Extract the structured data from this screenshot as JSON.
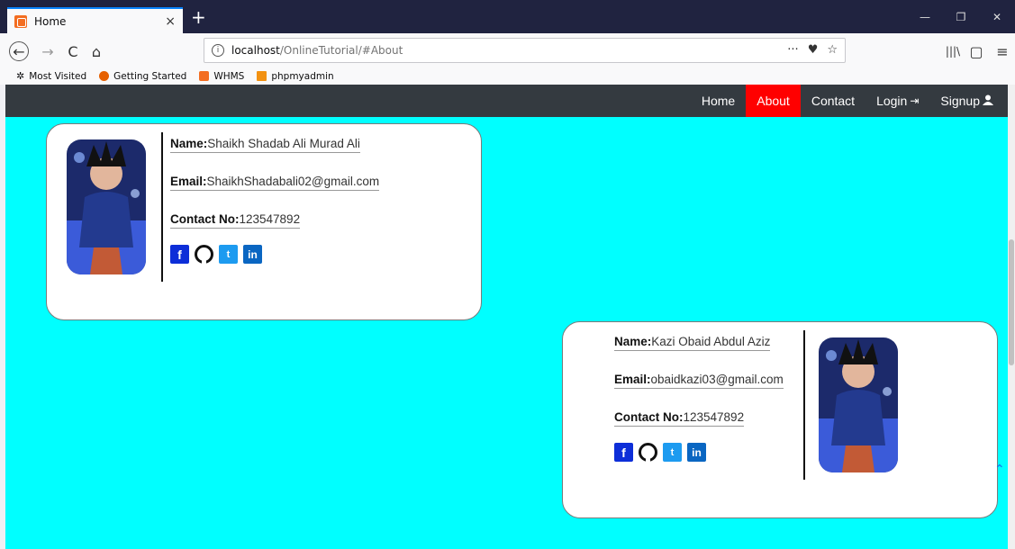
{
  "browser": {
    "tab": {
      "title": "Home",
      "close": "×"
    },
    "new_tab": "+",
    "window_controls": [
      "—",
      "❐",
      "✕"
    ],
    "nav": {
      "back": "←",
      "forward": "→",
      "reload": "C",
      "home": "⌂"
    },
    "url": {
      "host": "localhost",
      "path": "/OnlineTutorial/#About",
      "info": "i"
    },
    "url_actions": [
      "···",
      "♥",
      "☆"
    ],
    "toolbar_right": [
      "|||\\",
      "▢",
      "≡"
    ],
    "bookmarks": [
      {
        "label": "Most Visited",
        "icon": "gear-icon",
        "color": "#555555"
      },
      {
        "label": "Getting Started",
        "icon": "firefox-icon",
        "color": "#e66000"
      },
      {
        "label": "WHMS",
        "icon": "xampp-icon",
        "color": "#f36d21"
      },
      {
        "label": "phpmyadmin",
        "icon": "phpmyadmin-icon",
        "color": "#f29111"
      }
    ]
  },
  "site": {
    "nav": [
      {
        "label": "Home",
        "active": false
      },
      {
        "label": "About",
        "active": true
      },
      {
        "label": "Contact",
        "active": false
      },
      {
        "label": "Login",
        "glyph": "⇥"
      },
      {
        "label": "Signup",
        "glyph": "👤"
      }
    ],
    "cards": [
      {
        "name_label": "Name:",
        "name": "Shaikh Shadab Ali Murad Ali",
        "email_label": "Email:",
        "email": "ShaikhShadabali02@gmail.com",
        "contact_label": "Contact No:",
        "contact": "123547892"
      },
      {
        "name_label": "Name:",
        "name": "Kazi Obaid Abdul Aziz",
        "email_label": "Email:",
        "email": "obaidkazi03@gmail.com",
        "contact_label": "Contact No:",
        "contact": "123547892"
      }
    ],
    "socials": [
      "f",
      "",
      "t",
      "in"
    ],
    "colors": {
      "page_bg": "#00ffff",
      "nav_bg": "#343a40",
      "active": "#ff0000"
    }
  }
}
